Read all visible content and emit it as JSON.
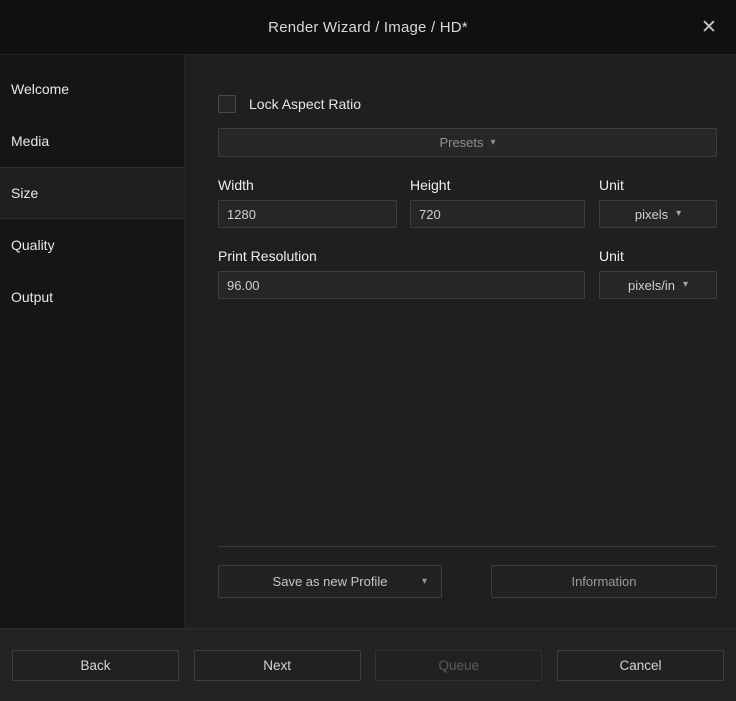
{
  "colors": {
    "background": "#1f1f1f",
    "titlebar": "#101010",
    "sidebar": "#151515",
    "input_background": "#262626",
    "border": "#3e3e3e",
    "text": "#e0e0e0",
    "muted_text": "#8f8f8f"
  },
  "icons": {
    "close": "✕",
    "dropdown_arrow": "▾"
  },
  "title_bar": {
    "title": "Render Wizard / Image / HD*"
  },
  "sidebar": {
    "items": [
      {
        "label": "Welcome"
      },
      {
        "label": "Media"
      },
      {
        "label": "Size"
      },
      {
        "label": "Quality"
      },
      {
        "label": "Output"
      }
    ],
    "selected": "Size"
  },
  "main": {
    "lock_aspect_ratio": {
      "label": "Lock Aspect Ratio",
      "checked": false
    },
    "presets": {
      "label": "Presets"
    },
    "width": {
      "label": "Width",
      "value": "1280"
    },
    "height": {
      "label": "Height",
      "value": "720"
    },
    "size_unit": {
      "label": "Unit",
      "value": "pixels"
    },
    "print_resolution": {
      "label": "Print Resolution",
      "value": "96.00"
    },
    "resolution_unit": {
      "label": "Unit",
      "value": "pixels/in"
    },
    "save_profile": {
      "label": "Save as new Profile"
    },
    "information": {
      "label": "Information"
    }
  },
  "footer": {
    "buttons": [
      {
        "label": "Back",
        "enabled": true
      },
      {
        "label": "Next",
        "enabled": true
      },
      {
        "label": "Queue",
        "enabled": false
      },
      {
        "label": "Cancel",
        "enabled": true
      }
    ]
  }
}
